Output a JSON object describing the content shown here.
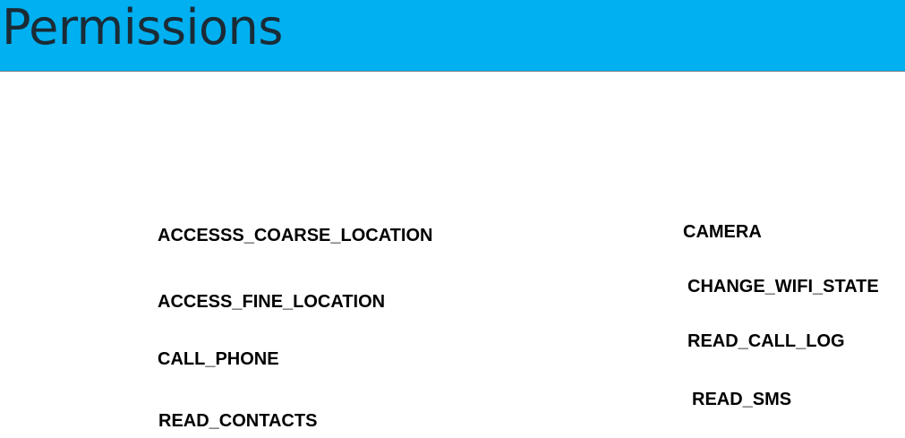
{
  "title": "Permissions",
  "colors": {
    "header_background": "#00b0f0",
    "title_text": "#1b2b36",
    "item_text": "#000000"
  },
  "permissions": {
    "left": [
      "ACCESSS_COARSE_LOCATION",
      "ACCESS_FINE_LOCATION",
      "CALL_PHONE",
      "READ_CONTACTS"
    ],
    "right": [
      "CAMERA",
      "CHANGE_WIFI_STATE",
      "READ_CALL_LOG",
      "READ_SMS"
    ]
  }
}
